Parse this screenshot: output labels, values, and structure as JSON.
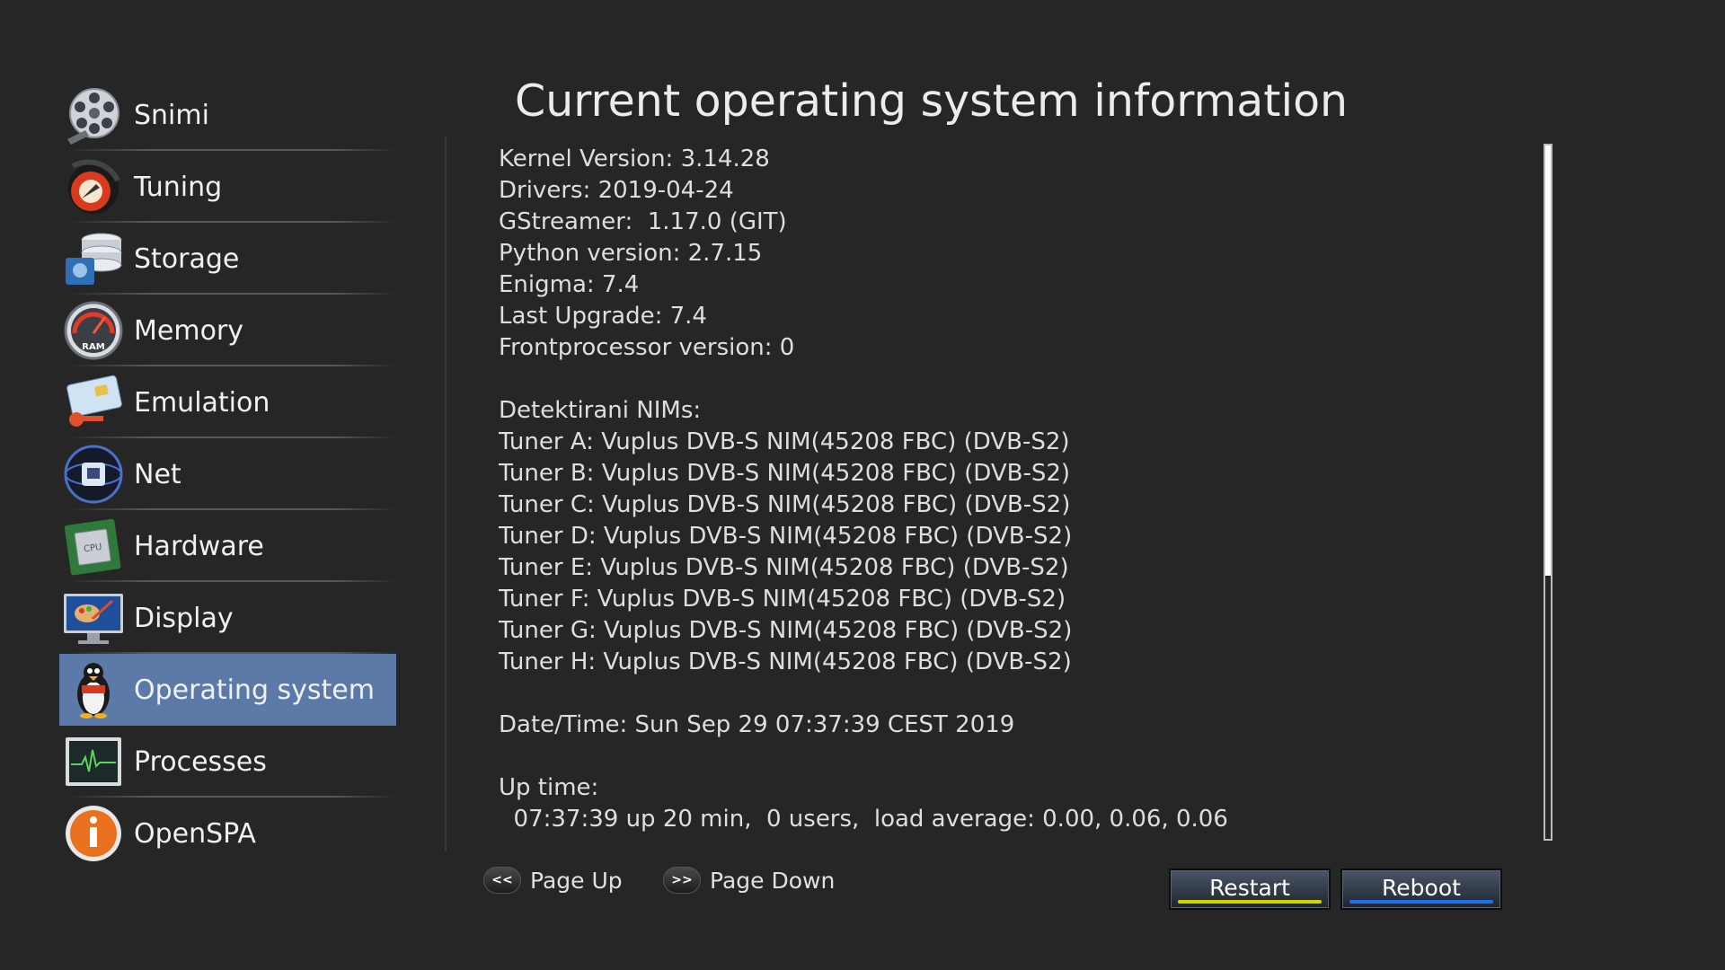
{
  "sidebar": {
    "items": [
      {
        "label": "Snimi",
        "icon": "film-reel-icon",
        "selected": false
      },
      {
        "label": "Tuning",
        "icon": "satellite-dish-icon",
        "selected": false
      },
      {
        "label": "Storage",
        "icon": "hard-drive-icon",
        "selected": false
      },
      {
        "label": "Memory",
        "icon": "ram-gauge-icon",
        "selected": false
      },
      {
        "label": "Emulation",
        "icon": "smartcard-key-icon",
        "selected": false
      },
      {
        "label": "Net",
        "icon": "network-globe-icon",
        "selected": false
      },
      {
        "label": "Hardware",
        "icon": "cpu-chip-icon",
        "selected": true
      },
      {
        "label": "Display",
        "icon": "monitor-palette-icon",
        "selected": false
      },
      {
        "label": "Operating system",
        "icon": "penguin-icon",
        "selected": true
      },
      {
        "label": "Processes",
        "icon": "activity-monitor-icon",
        "selected": false
      },
      {
        "label": "OpenSPA",
        "icon": "info-icon",
        "selected": false
      }
    ],
    "selected_color": "#5b7aa8"
  },
  "main": {
    "title": "Current operating system information",
    "lines": [
      "Kernel Version: 3.14.28",
      "Drivers: 2019-04-24",
      "GStreamer:  1.17.0 (GIT)",
      "Python version: 2.7.15",
      "Enigma: 7.4",
      "Last Upgrade: 7.4",
      "Frontprocessor version: 0",
      "",
      "Detektirani NIMs:",
      "Tuner A: Vuplus DVB-S NIM(45208 FBC) (DVB-S2)",
      "Tuner B: Vuplus DVB-S NIM(45208 FBC) (DVB-S2)",
      "Tuner C: Vuplus DVB-S NIM(45208 FBC) (DVB-S2)",
      "Tuner D: Vuplus DVB-S NIM(45208 FBC) (DVB-S2)",
      "Tuner E: Vuplus DVB-S NIM(45208 FBC) (DVB-S2)",
      "Tuner F: Vuplus DVB-S NIM(45208 FBC) (DVB-S2)",
      "Tuner G: Vuplus DVB-S NIM(45208 FBC) (DVB-S2)",
      "Tuner H: Vuplus DVB-S NIM(45208 FBC) (DVB-S2)",
      "",
      "Date/Time: Sun Sep 29 07:37:39 CEST 2019",
      "",
      "Up time:",
      "  07:37:39 up 20 min,  0 users,  load average: 0.00, 0.06, 0.06"
    ],
    "scroll_fraction": 0.62
  },
  "footer": {
    "page_up": {
      "key": "<<",
      "label": "Page Up"
    },
    "page_down": {
      "key": ">>",
      "label": "Page Down"
    },
    "restart": {
      "label": "Restart",
      "color": "#d4d400"
    },
    "reboot": {
      "label": "Reboot",
      "color": "#1e6ef0"
    }
  }
}
